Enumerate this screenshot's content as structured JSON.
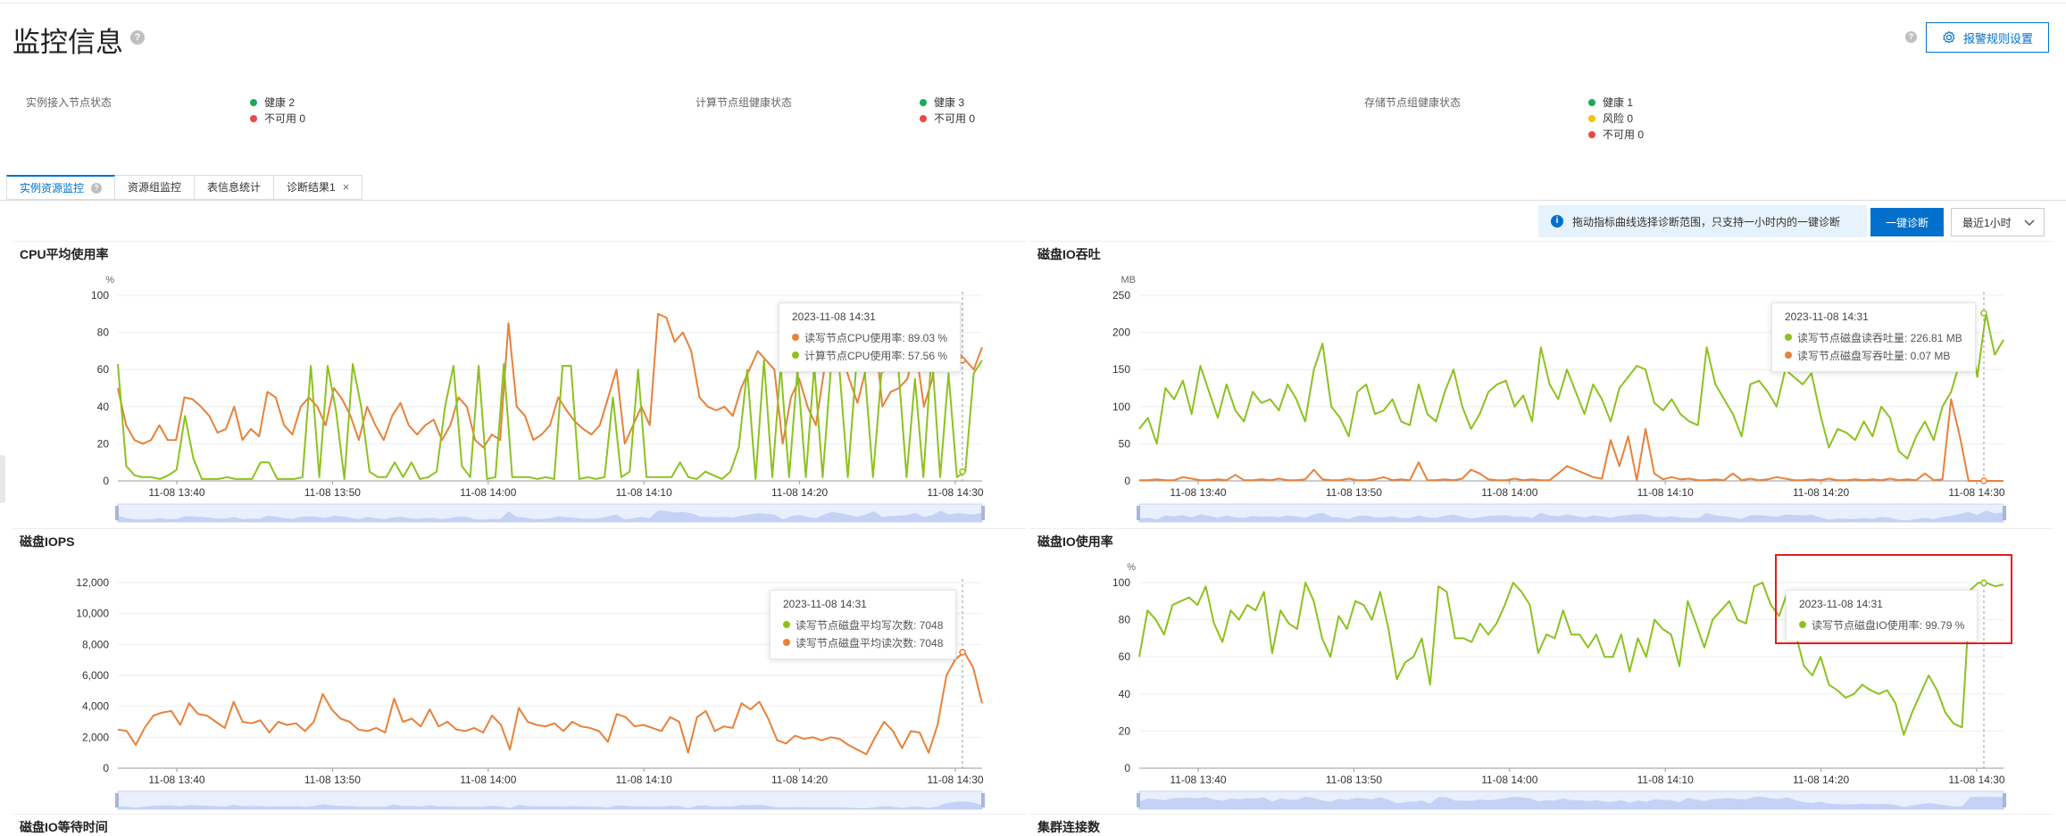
{
  "header": {
    "title": "监控信息",
    "alarm_button": "报警规则设置"
  },
  "status": {
    "groups": [
      {
        "label": "实例接入节点状态",
        "items": [
          {
            "text": "健康 2",
            "color": "#1aaa55"
          },
          {
            "text": "不可用 0",
            "color": "#e84848"
          }
        ]
      },
      {
        "label": "计算节点组健康状态",
        "items": [
          {
            "text": "健康 3",
            "color": "#1aaa55"
          },
          {
            "text": "不可用 0",
            "color": "#e84848"
          }
        ]
      },
      {
        "label": "存储节点组健康状态",
        "items": [
          {
            "text": "健康 1",
            "color": "#1aaa55"
          },
          {
            "text": "风险 0",
            "color": "#f2c400"
          },
          {
            "text": "不可用 0",
            "color": "#e84848"
          }
        ]
      }
    ]
  },
  "tabs": [
    {
      "label": "实例资源监控",
      "active": true
    },
    {
      "label": "资源组监控"
    },
    {
      "label": "表信息统计"
    },
    {
      "label": "诊断结果1",
      "closable": true
    }
  ],
  "toolbar": {
    "info_text": "拖动指标曲线选择诊断范围，只支持一小时内的一键诊断",
    "diagnose_button": "一键诊断",
    "time_range": "最近1小时"
  },
  "colors": {
    "orange": "#e8813a",
    "green": "#8cc21f",
    "accent": "#0070cc"
  },
  "chart_data": [
    {
      "type": "line",
      "title": "CPU平均使用率",
      "unit": "%",
      "ylim": [
        0,
        100
      ],
      "yticks": [
        "0",
        "20",
        "40",
        "60",
        "80",
        "100"
      ],
      "xticks": [
        "11-08 13:40",
        "11-08 13:50",
        "11-08 14:00",
        "11-08 14:10",
        "11-08 14:20",
        "11-08 14:30"
      ],
      "tooltip": {
        "time": "2023-11-08 14:31",
        "rows": [
          {
            "label": "读写节点CPU使用率: 89.03 %",
            "color": "#e8813a"
          },
          {
            "label": "计算节点CPU使用率: 57.56 %",
            "color": "#8cc21f"
          }
        ]
      },
      "series": [
        {
          "color": "#e8813a",
          "values": [
            50,
            30,
            22,
            20,
            22,
            30,
            22,
            22,
            45,
            44,
            40,
            35,
            26,
            28,
            40,
            22,
            28,
            24,
            48,
            45,
            30,
            25,
            40,
            45,
            40,
            30,
            50,
            44,
            35,
            22,
            40,
            30,
            22,
            35,
            42,
            30,
            25,
            30,
            33,
            22,
            30,
            45,
            40,
            22,
            18,
            25,
            22,
            85,
            40,
            35,
            22,
            25,
            30,
            45,
            38,
            32,
            28,
            25,
            30,
            45,
            60,
            20,
            30,
            40,
            30,
            90,
            88,
            75,
            80,
            70,
            45,
            40,
            38,
            40,
            35,
            50,
            60,
            70,
            65,
            60,
            20,
            45,
            55,
            40,
            30,
            60,
            80,
            70,
            55,
            42,
            60,
            85,
            40,
            48,
            50,
            55,
            72,
            40,
            55,
            89,
            60,
            70,
            65,
            60,
            72
          ]
        },
        {
          "color": "#8cc21f",
          "values": [
            63,
            8,
            3,
            2,
            2,
            1,
            3,
            6,
            35,
            12,
            1,
            1,
            1,
            2,
            1,
            1,
            1,
            10,
            10,
            1,
            1,
            1,
            2,
            62,
            2,
            62,
            38,
            1,
            63,
            40,
            5,
            2,
            2,
            10,
            2,
            10,
            1,
            2,
            5,
            40,
            62,
            8,
            2,
            62,
            1,
            2,
            63,
            2,
            2,
            2,
            1,
            2,
            1,
            62,
            62,
            1,
            2,
            1,
            2,
            45,
            2,
            5,
            60,
            2,
            2,
            2,
            2,
            10,
            2,
            1,
            5,
            3,
            1,
            5,
            18,
            60,
            1,
            65,
            2,
            62,
            2,
            60,
            2,
            62,
            2,
            62,
            60,
            2,
            62,
            60,
            2,
            58,
            62,
            62,
            2,
            55,
            2,
            70,
            2,
            58,
            2,
            5,
            58,
            65
          ]
        }
      ]
    },
    {
      "type": "line",
      "title": "磁盘IO吞吐",
      "unit": "MB",
      "ylim": [
        0,
        250
      ],
      "yticks": [
        "0",
        "50",
        "100",
        "150",
        "200",
        "250"
      ],
      "xticks": [
        "11-08 13:40",
        "11-08 13:50",
        "11-08 14:00",
        "11-08 14:10",
        "11-08 14:20",
        "11-08 14:30"
      ],
      "tooltip": {
        "time": "2023-11-08 14:31",
        "rows": [
          {
            "label": "读写节点磁盘读吞吐量: 226.81 MB",
            "color": "#8cc21f"
          },
          {
            "label": "读写节点磁盘写吞吐量: 0.07 MB",
            "color": "#e8813a"
          }
        ]
      },
      "series": [
        {
          "color": "#8cc21f",
          "values": [
            70,
            85,
            50,
            125,
            110,
            135,
            90,
            155,
            120,
            85,
            130,
            95,
            80,
            120,
            105,
            110,
            95,
            130,
            110,
            80,
            150,
            185,
            100,
            85,
            60,
            120,
            130,
            90,
            95,
            110,
            80,
            75,
            130,
            90,
            80,
            120,
            150,
            100,
            70,
            90,
            120,
            130,
            135,
            100,
            115,
            80,
            180,
            130,
            110,
            150,
            120,
            90,
            130,
            110,
            80,
            125,
            140,
            155,
            150,
            105,
            95,
            110,
            90,
            80,
            75,
            180,
            130,
            110,
            90,
            60,
            130,
            135,
            120,
            100,
            150,
            140,
            130,
            145,
            90,
            45,
            70,
            65,
            55,
            80,
            60,
            100,
            85,
            40,
            30,
            60,
            80,
            55,
            100,
            120,
            160,
            200,
            140,
            226,
            170,
            190
          ]
        },
        {
          "color": "#e8813a",
          "values": [
            1,
            1,
            2,
            1,
            1,
            5,
            3,
            1,
            1,
            2,
            1,
            8,
            1,
            1,
            2,
            1,
            3,
            1,
            1,
            2,
            15,
            2,
            1,
            1,
            3,
            1,
            1,
            2,
            5,
            1,
            2,
            1,
            25,
            1,
            1,
            2,
            1,
            3,
            15,
            10,
            2,
            1,
            1,
            3,
            1,
            2,
            1,
            1,
            10,
            20,
            15,
            10,
            5,
            3,
            55,
            20,
            60,
            1,
            70,
            10,
            2,
            5,
            2,
            3,
            1,
            1,
            2,
            1,
            10,
            1,
            3,
            1,
            2,
            5,
            3,
            1,
            1,
            2,
            1,
            3,
            1,
            1,
            2,
            1,
            2,
            1,
            3,
            1,
            2,
            1,
            10,
            1,
            2,
            110,
            60,
            0,
            0,
            0,
            0,
            0
          ]
        }
      ]
    },
    {
      "type": "line",
      "title": "磁盘IOPS",
      "ylim": [
        0,
        12000
      ],
      "yticks": [
        "0",
        "2,000",
        "4,000",
        "6,000",
        "8,000",
        "10,000",
        "12,000"
      ],
      "xticks": [
        "11-08 13:40",
        "11-08 13:50",
        "11-08 14:00",
        "11-08 14:10",
        "11-08 14:20",
        "11-08 14:30"
      ],
      "tooltip": {
        "time": "2023-11-08 14:31",
        "rows": [
          {
            "label": "读写节点磁盘平均写次数: 7048",
            "color": "#8cc21f"
          },
          {
            "label": "读写节点磁盘平均读次数: 7048",
            "color": "#e8813a"
          }
        ]
      },
      "series": [
        {
          "color": "#e8813a",
          "values": [
            2500,
            2400,
            1500,
            2600,
            3400,
            3600,
            3700,
            2800,
            4200,
            3500,
            3400,
            3000,
            2600,
            4300,
            3000,
            2900,
            3100,
            2300,
            3000,
            2800,
            2900,
            2400,
            3000,
            4800,
            3800,
            3200,
            3000,
            2500,
            2400,
            2600,
            2300,
            4500,
            3000,
            3200,
            2700,
            3800,
            2700,
            3000,
            2500,
            2400,
            2600,
            2300,
            3400,
            2800,
            1200,
            3900,
            3000,
            2800,
            2700,
            2900,
            2400,
            3000,
            2700,
            2600,
            2400,
            1700,
            3500,
            3300,
            2700,
            2800,
            2600,
            2400,
            3300,
            3000,
            1000,
            3300,
            3700,
            2400,
            2700,
            2600,
            4200,
            3800,
            4300,
            3200,
            1800,
            1600,
            2100,
            1900,
            2000,
            1800,
            2000,
            1900,
            1500,
            1200,
            900,
            2000,
            3000,
            2400,
            1300,
            2400,
            2300,
            1000,
            2800,
            6000,
            7048,
            7500,
            6500,
            4200
          ]
        }
      ]
    },
    {
      "type": "line",
      "title": "磁盘IO使用率",
      "unit": "%",
      "ylim": [
        0,
        100
      ],
      "yticks": [
        "0",
        "20",
        "40",
        "60",
        "80",
        "100"
      ],
      "xticks": [
        "11-08 13:40",
        "11-08 13:50",
        "11-08 14:00",
        "11-08 14:10",
        "11-08 14:20",
        "11-08 14:30"
      ],
      "tooltip": {
        "time": "2023-11-08 14:31",
        "rows": [
          {
            "label": "读写节点磁盘IO使用率: 99.79 %",
            "color": "#8cc21f"
          }
        ]
      },
      "series": [
        {
          "color": "#8cc21f",
          "values": [
            60,
            85,
            80,
            72,
            88,
            90,
            92,
            88,
            98,
            78,
            68,
            85,
            80,
            88,
            85,
            95,
            62,
            85,
            78,
            75,
            100,
            90,
            70,
            60,
            82,
            75,
            90,
            88,
            80,
            95,
            75,
            48,
            57,
            60,
            70,
            45,
            98,
            95,
            70,
            70,
            68,
            78,
            72,
            78,
            88,
            100,
            95,
            88,
            62,
            72,
            70,
            85,
            72,
            72,
            65,
            72,
            60,
            60,
            72,
            52,
            70,
            60,
            80,
            75,
            72,
            55,
            90,
            78,
            65,
            80,
            85,
            90,
            80,
            78,
            98,
            100,
            88,
            82,
            95,
            72,
            55,
            50,
            60,
            45,
            42,
            38,
            40,
            45,
            42,
            40,
            42,
            35,
            18,
            30,
            40,
            50,
            42,
            30,
            24,
            22,
            96,
            100,
            99.79,
            98,
            99
          ]
        }
      ]
    },
    {
      "type": "line",
      "title": "磁盘IO等待时间",
      "series": []
    },
    {
      "type": "line",
      "title": "集群连接数",
      "series": []
    }
  ]
}
